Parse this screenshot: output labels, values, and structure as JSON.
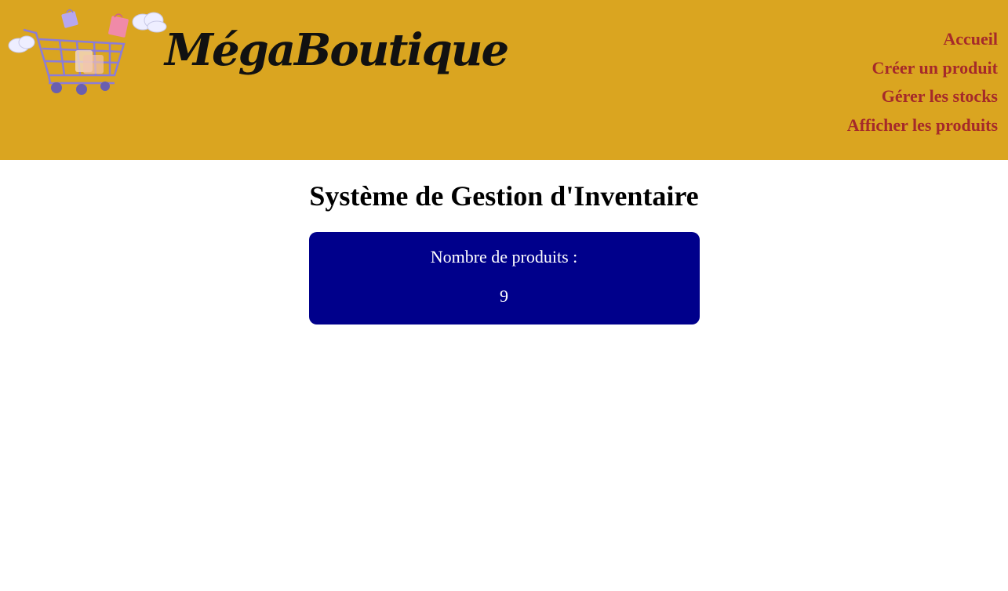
{
  "header": {
    "brand": "MégaBoutique",
    "background_color": "#DAA520",
    "logo_icon": "shopping-cart-icon"
  },
  "nav": {
    "items": [
      {
        "label": "Accueil"
      },
      {
        "label": "Créer un produit"
      },
      {
        "label": "Gérer les stocks"
      },
      {
        "label": "Afficher les produits"
      }
    ],
    "link_color": "#A52A2A"
  },
  "main": {
    "title": "Système de Gestion d'Inventaire",
    "card": {
      "label": "Nombre de produits :",
      "value": "9",
      "background_color": "#00008B"
    }
  }
}
